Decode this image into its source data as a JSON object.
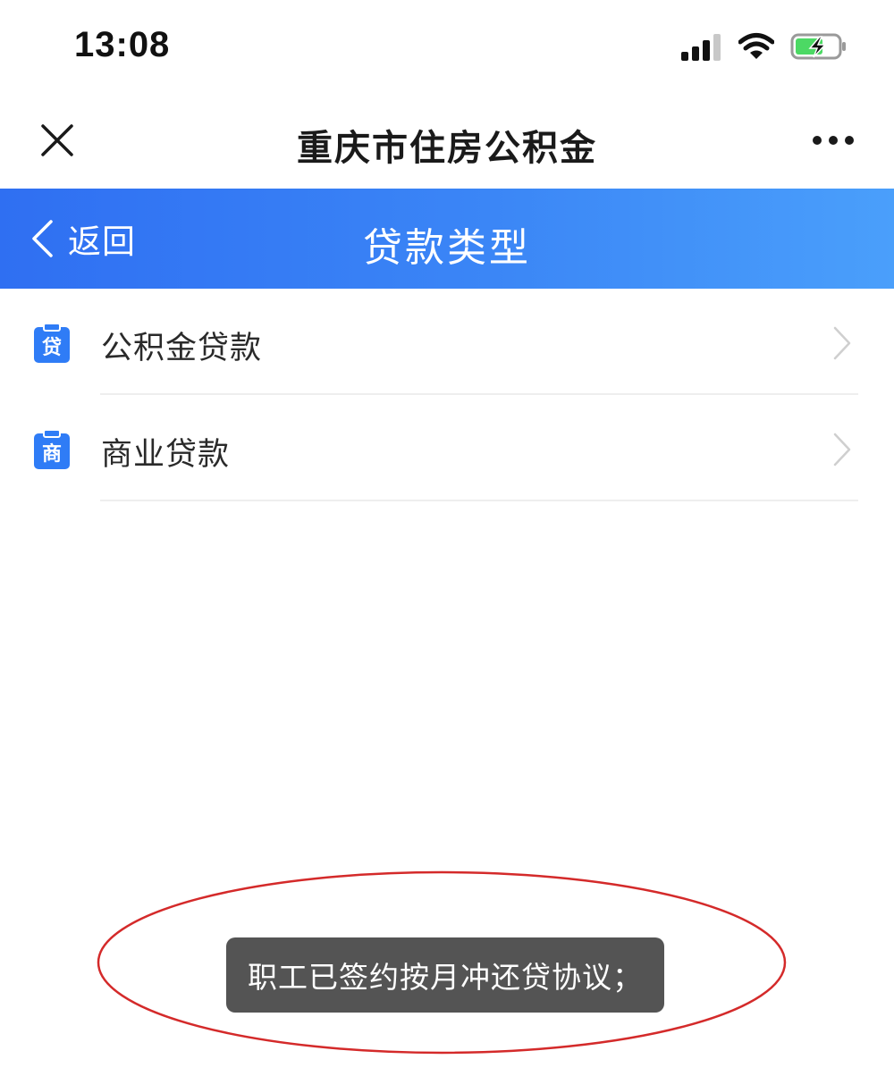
{
  "status_bar": {
    "time": "13:08",
    "icons": [
      "signal-icon",
      "wifi-icon",
      "battery-charging-icon"
    ]
  },
  "title_bar": {
    "title": "重庆市住房公积金",
    "left_icon": "close-icon",
    "right_icon": "more-icon"
  },
  "header": {
    "back_label": "返回",
    "title": "贷款类型",
    "gradient_colors": [
      "#2f6ff2",
      "#4a9ffb"
    ]
  },
  "loan_types": [
    {
      "label": "公积金贷款",
      "icon_char": "贷",
      "icon": "loan-icon"
    },
    {
      "label": "商业贷款",
      "icon_char": "商",
      "icon": "commercial-icon"
    }
  ],
  "toast": {
    "message": "职工已签约按月冲还贷协议；"
  },
  "colors": {
    "accent": "#2f7cf6",
    "toast_bg": "#545454",
    "annotation": "#d42a2a"
  }
}
